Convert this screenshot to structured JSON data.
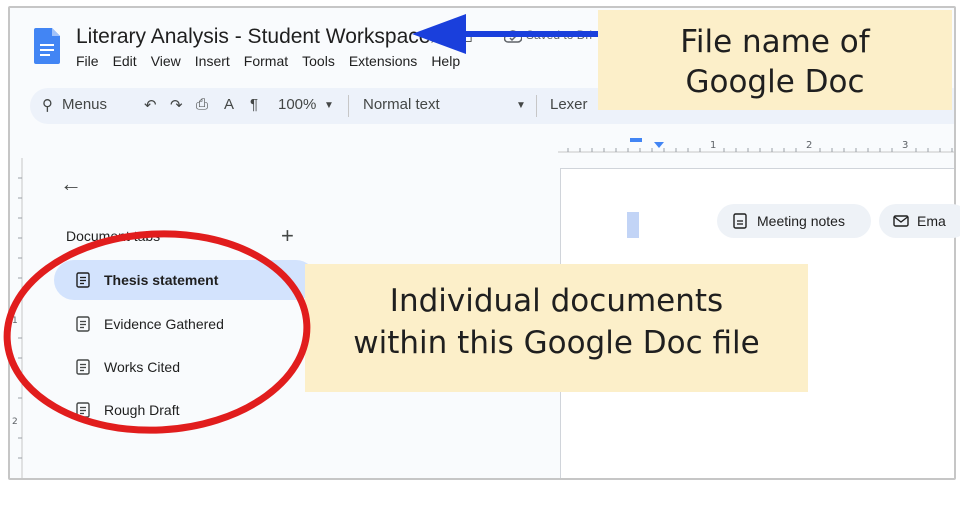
{
  "header": {
    "title": "Literary Analysis  - Student Workspace",
    "saved_status": "Saved to Dri",
    "menu": [
      "File",
      "Edit",
      "View",
      "Insert",
      "Format",
      "Tools",
      "Extensions",
      "Help"
    ]
  },
  "toolbar": {
    "search_label": "Menus",
    "zoom": "100%",
    "style": "Normal text",
    "font": "Lexer"
  },
  "ruler": {
    "labels": [
      "1",
      "2",
      "3"
    ]
  },
  "vertical_ruler": {
    "labels": [
      "1",
      "2"
    ]
  },
  "sidebar": {
    "heading": "Document tabs",
    "add_symbol": "+",
    "tabs": [
      {
        "label": "Thesis statement",
        "active": true
      },
      {
        "label": "Evidence Gathered",
        "active": false
      },
      {
        "label": "Works Cited",
        "active": false
      },
      {
        "label": "Rough Draft",
        "active": false
      }
    ]
  },
  "page": {
    "chips": [
      "Meeting notes",
      "Ema"
    ]
  },
  "annotations": {
    "top_callout_line1": "File name of",
    "top_callout_line2": "Google Doc",
    "mid_callout_line1": "Individual documents",
    "mid_callout_line2": "within this Google Doc file"
  },
  "colors": {
    "arrow": "#1a3fdc",
    "highlight_circle": "#e11d1d",
    "callout_bg": "#fcefc9",
    "active_tab_bg": "#d3e3fd",
    "docs_blue": "#4285f4"
  }
}
